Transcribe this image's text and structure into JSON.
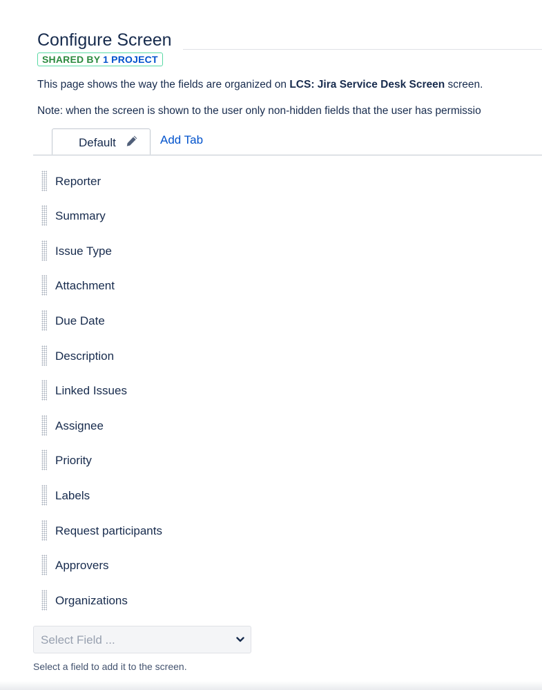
{
  "header": {
    "title": "Configure Screen",
    "badge_shared": "SHARED BY",
    "badge_project": "1 PROJECT"
  },
  "intro": {
    "prefix": "This page shows the way the fields are organized on",
    "screen_name": "LCS: Jira Service Desk Screen",
    "suffix": "screen."
  },
  "note": "Note: when the screen is shown to the user only non-hidden fields that the user has permissio",
  "tabs": {
    "active_label": "Default",
    "add_label": "Add Tab"
  },
  "fields": [
    {
      "label": "Reporter"
    },
    {
      "label": "Summary"
    },
    {
      "label": "Issue Type"
    },
    {
      "label": "Attachment"
    },
    {
      "label": "Due Date"
    },
    {
      "label": "Description"
    },
    {
      "label": "Linked Issues"
    },
    {
      "label": "Assignee"
    },
    {
      "label": "Priority"
    },
    {
      "label": "Labels"
    },
    {
      "label": "Request participants"
    },
    {
      "label": "Approvers"
    },
    {
      "label": "Organizations"
    }
  ],
  "select_field": {
    "placeholder": "Select Field ...",
    "help": "Select a field to add it to the screen."
  },
  "icons": {
    "edit_tab": "pencil-icon",
    "dropdown": "chevron-down-icon",
    "drag": "drag-handle-icon"
  },
  "colors": {
    "link": "#0052cc",
    "text": "#172b4d",
    "badge_green": "#2b8a3e",
    "badge_border": "#57d9a3"
  }
}
